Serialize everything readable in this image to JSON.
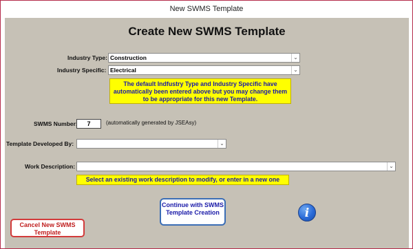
{
  "window": {
    "title": "New SWMS Template"
  },
  "form": {
    "heading": "Create New SWMS Template",
    "industry_type": {
      "label": "Industry Type:",
      "value": "Construction"
    },
    "industry_specific": {
      "label": "Industry Specific:",
      "value": "Electrical"
    },
    "default_note": "The default Indfustry Type and Industry Specific have automatically been entered above but you may change them to be appropriate for this new Template.",
    "swms_number": {
      "label": "SWMS Number:",
      "value": "7",
      "note": "(automatically generated by JSEAsy)"
    },
    "template_developed_by": {
      "label": "Template Developed By:",
      "value": ""
    },
    "work_description": {
      "label": "Work Description:",
      "value": "",
      "hint": "Select an existing work description to modify, or enter in a new one"
    }
  },
  "buttons": {
    "continue": "Continue with SWMS Template Creation",
    "cancel": "Cancel New SWMS Template"
  },
  "icons": {
    "info": "i",
    "dropdown_arrow": "⌄"
  },
  "colors": {
    "form_background": "#c6c1b6",
    "note_background": "#ffff00",
    "note_text": "#1a1aa8",
    "continue_border": "#3a6db5",
    "cancel_border": "#d23a3a",
    "cancel_text": "#c01e1e",
    "window_border": "#b42a4a"
  }
}
